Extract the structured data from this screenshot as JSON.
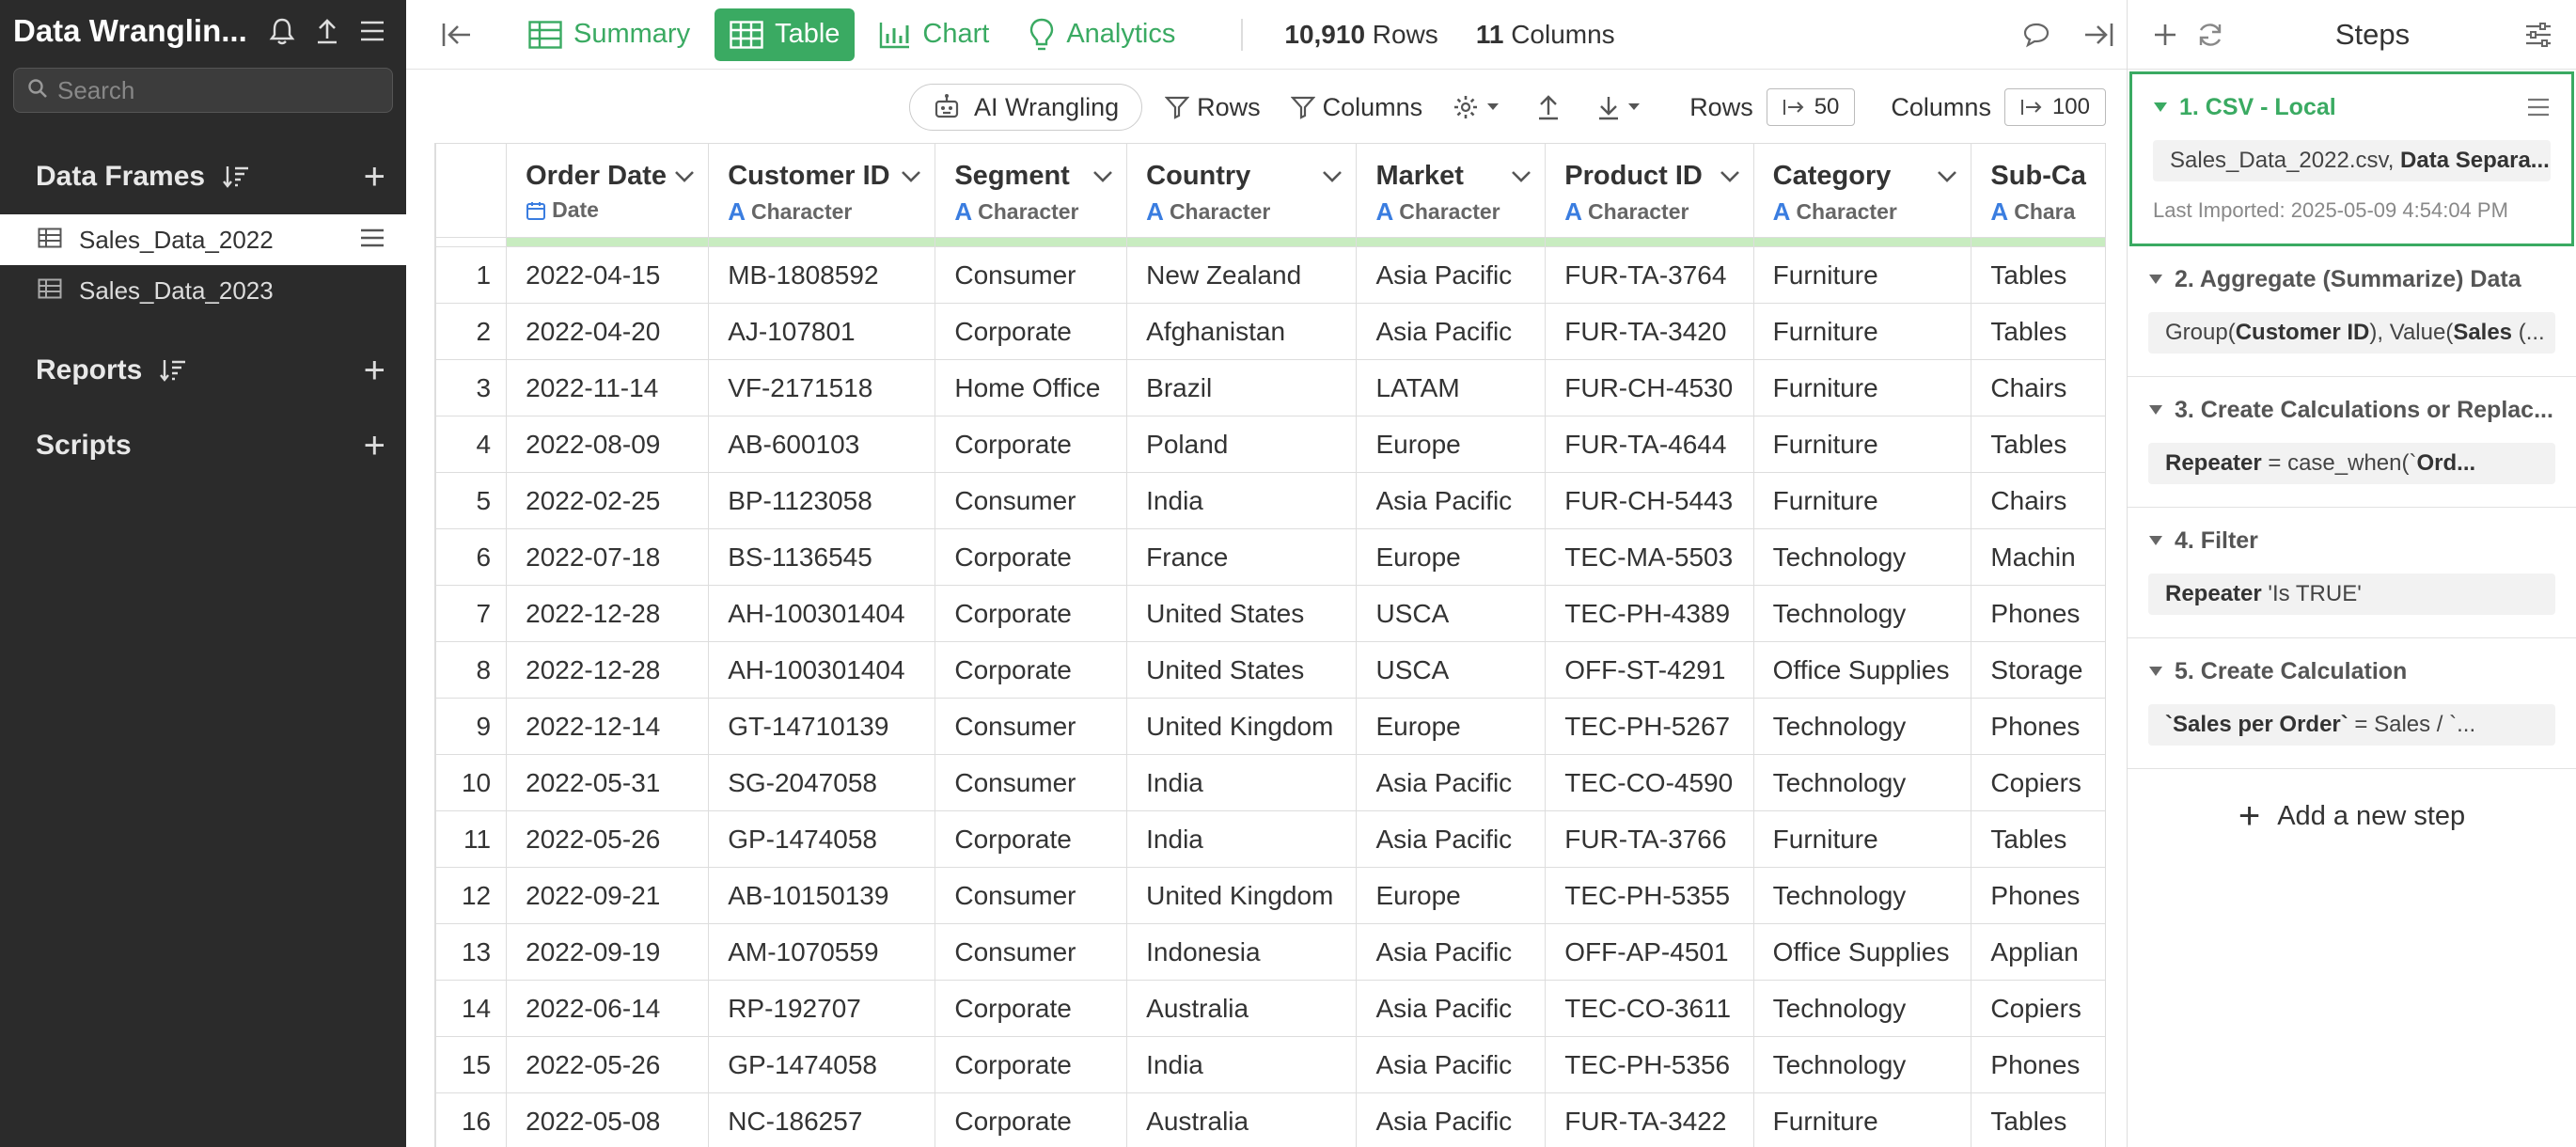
{
  "app": {
    "title": "Data Wranglin..."
  },
  "colors": {
    "accent": "#3aaa62",
    "sidebar": "#2b2b2b",
    "type_icon": "#3a7de0",
    "highlight": "#c8ecc0"
  },
  "sidebar": {
    "search_placeholder": "Search",
    "data_frames_label": "Data Frames",
    "data_frames": [
      "Sales_Data_2022",
      "Sales_Data_2023"
    ],
    "reports_label": "Reports",
    "scripts_label": "Scripts"
  },
  "toolbar": {
    "summary": "Summary",
    "table": "Table",
    "chart": "Chart",
    "analytics": "Analytics",
    "rows_count": "10,910",
    "rows_label": "Rows",
    "cols_count": "11",
    "cols_label": "Columns"
  },
  "subbar": {
    "ai_wrangling": "AI Wrangling",
    "rows_filter": "Rows",
    "columns_filter": "Columns",
    "rows_label": "Rows",
    "rows_value": "50",
    "columns_label": "Columns",
    "columns_value": "100"
  },
  "table": {
    "columns": [
      {
        "name": "Order Date",
        "type": "Date"
      },
      {
        "name": "Customer ID",
        "type": "Character"
      },
      {
        "name": "Segment",
        "type": "Character"
      },
      {
        "name": "Country",
        "type": "Character"
      },
      {
        "name": "Market",
        "type": "Character"
      },
      {
        "name": "Product ID",
        "type": "Character"
      },
      {
        "name": "Category",
        "type": "Character"
      },
      {
        "name": "Sub-Ca",
        "type": "Chara"
      }
    ],
    "rows": [
      [
        "1",
        "2022-04-15",
        "MB-1808592",
        "Consumer",
        "New Zealand",
        "Asia Pacific",
        "FUR-TA-3764",
        "Furniture",
        "Tables"
      ],
      [
        "2",
        "2022-04-20",
        "AJ-107801",
        "Corporate",
        "Afghanistan",
        "Asia Pacific",
        "FUR-TA-3420",
        "Furniture",
        "Tables"
      ],
      [
        "3",
        "2022-11-14",
        "VF-2171518",
        "Home Office",
        "Brazil",
        "LATAM",
        "FUR-CH-4530",
        "Furniture",
        "Chairs"
      ],
      [
        "4",
        "2022-08-09",
        "AB-600103",
        "Corporate",
        "Poland",
        "Europe",
        "FUR-TA-4644",
        "Furniture",
        "Tables"
      ],
      [
        "5",
        "2022-02-25",
        "BP-1123058",
        "Consumer",
        "India",
        "Asia Pacific",
        "FUR-CH-5443",
        "Furniture",
        "Chairs"
      ],
      [
        "6",
        "2022-07-18",
        "BS-1136545",
        "Corporate",
        "France",
        "Europe",
        "TEC-MA-5503",
        "Technology",
        "Machin"
      ],
      [
        "7",
        "2022-12-28",
        "AH-100301404",
        "Corporate",
        "United States",
        "USCA",
        "TEC-PH-4389",
        "Technology",
        "Phones"
      ],
      [
        "8",
        "2022-12-28",
        "AH-100301404",
        "Corporate",
        "United States",
        "USCA",
        "OFF-ST-4291",
        "Office Supplies",
        "Storage"
      ],
      [
        "9",
        "2022-12-14",
        "GT-14710139",
        "Consumer",
        "United Kingdom",
        "Europe",
        "TEC-PH-5267",
        "Technology",
        "Phones"
      ],
      [
        "10",
        "2022-05-31",
        "SG-2047058",
        "Consumer",
        "India",
        "Asia Pacific",
        "TEC-CO-4590",
        "Technology",
        "Copiers"
      ],
      [
        "11",
        "2022-05-26",
        "GP-1474058",
        "Corporate",
        "India",
        "Asia Pacific",
        "FUR-TA-3766",
        "Furniture",
        "Tables"
      ],
      [
        "12",
        "2022-09-21",
        "AB-10150139",
        "Consumer",
        "United Kingdom",
        "Europe",
        "TEC-PH-5355",
        "Technology",
        "Phones"
      ],
      [
        "13",
        "2022-09-19",
        "AM-1070559",
        "Consumer",
        "Indonesia",
        "Asia Pacific",
        "OFF-AP-4501",
        "Office Supplies",
        "Applian"
      ],
      [
        "14",
        "2022-06-14",
        "RP-192707",
        "Corporate",
        "Australia",
        "Asia Pacific",
        "TEC-CO-3611",
        "Technology",
        "Copiers"
      ],
      [
        "15",
        "2022-05-26",
        "GP-1474058",
        "Corporate",
        "India",
        "Asia Pacific",
        "TEC-PH-5356",
        "Technology",
        "Phones"
      ],
      [
        "16",
        "2022-05-08",
        "NC-186257",
        "Corporate",
        "Australia",
        "Asia Pacific",
        "FUR-TA-3422",
        "Furniture",
        "Tables"
      ]
    ]
  },
  "steps": {
    "title": "Steps",
    "items": [
      {
        "title": "1. CSV - Local",
        "summary_plain": "Sales_Data_2022.csv, ",
        "summary_bold": "Data Separa...",
        "meta": "Last Imported: 2025-05-09 4:54:04 PM"
      },
      {
        "title": "2. Aggregate (Summarize) Data",
        "p1": "Group(",
        "b1": "Customer ID",
        "p2": "), Value(",
        "b2": "Sales",
        "p3": " (..."
      },
      {
        "title": "3. Create Calculations or Replac...",
        "b1": "Repeater",
        "p1": " = case_when(`",
        "b2": "Ord..."
      },
      {
        "title": "4. Filter",
        "b1": "Repeater",
        "p1": " 'Is TRUE'"
      },
      {
        "title": "5. Create Calculation",
        "b1": "`Sales per Order`",
        "p1": " = Sales / `..."
      }
    ],
    "add_label": "Add a new step"
  }
}
